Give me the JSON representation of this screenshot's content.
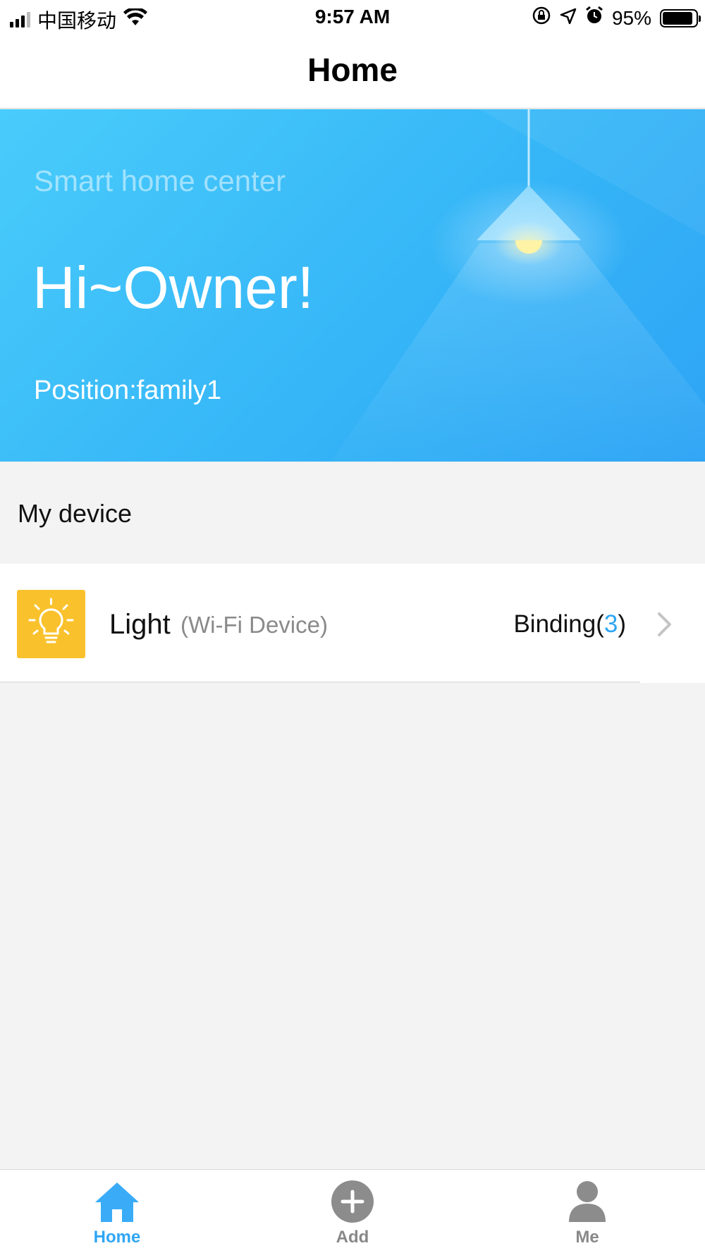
{
  "status_bar": {
    "carrier": "中国移动",
    "time": "9:57 AM",
    "battery_percent": "95%",
    "battery_level": 0.95,
    "icons": [
      "signal-icon",
      "wifi-icon",
      "rotation-lock-icon",
      "location-icon",
      "alarm-icon",
      "battery-icon"
    ]
  },
  "nav": {
    "title": "Home"
  },
  "banner": {
    "subtitle": "Smart home center",
    "greeting": "Hi~Owner!",
    "position": "Position:family1",
    "colors": {
      "start": "#49ccfb",
      "end": "#2ea4f5"
    }
  },
  "section": {
    "title": "My device"
  },
  "devices": [
    {
      "name": "Light",
      "type": "(Wi-Fi Device)",
      "binding_prefix": "Binding(",
      "binding_count": "3",
      "binding_suffix": ")",
      "icon": "lightbulb-icon",
      "icon_bg": "#f9c22d"
    }
  ],
  "tabs": [
    {
      "label": "Home",
      "icon": "home-icon",
      "active": true
    },
    {
      "label": "Add",
      "icon": "plus-circle-icon",
      "active": false
    },
    {
      "label": "Me",
      "icon": "person-icon",
      "active": false
    }
  ],
  "colors": {
    "accent": "#2fa6f4",
    "inactive": "#888888"
  }
}
